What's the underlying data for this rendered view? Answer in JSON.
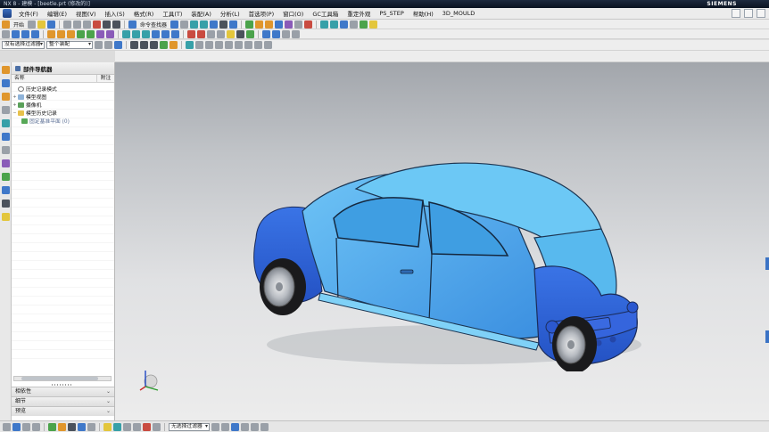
{
  "window": {
    "title": "NX 8 - 建模 - [beetle.prt (修改的)]",
    "brand": "SIEMENS"
  },
  "menu": {
    "items": [
      {
        "label": "文件(F)"
      },
      {
        "label": "编辑(E)"
      },
      {
        "label": "视图(V)"
      },
      {
        "label": "插入(S)"
      },
      {
        "label": "格式(R)"
      },
      {
        "label": "工具(T)"
      },
      {
        "label": "装配(A)"
      },
      {
        "label": "分析(L)"
      },
      {
        "label": "首选项(P)"
      },
      {
        "label": "窗口(O)"
      },
      {
        "label": "GC工具箱"
      },
      {
        "label": "重定外观"
      },
      {
        "label": "PS_STEP"
      },
      {
        "label": "帮助(H)"
      },
      {
        "label": "3D_MOULD"
      }
    ]
  },
  "toolbar": {
    "start_label": "开始",
    "command_finder_label": "命令查找器",
    "selection_filter": "没有选择过滤器",
    "assembly_scope": "整个装配"
  },
  "navigator": {
    "title": "部件导航器",
    "columns": {
      "name": "名称",
      "flag": "附注"
    },
    "tree": [
      {
        "label": "历史记录模式",
        "indent": 0,
        "icon": "history-icon"
      },
      {
        "label": "模型视图",
        "indent": 0,
        "icon": "model-views-icon"
      },
      {
        "label": "摄像机",
        "indent": 0,
        "icon": "camera-icon"
      },
      {
        "label": "模型历史记录",
        "indent": 0,
        "icon": "folder-icon"
      },
      {
        "label": "固定基准平面 (0)",
        "indent": 1,
        "icon": "datum-plane-icon"
      }
    ],
    "panels": [
      {
        "label": "相依性"
      },
      {
        "label": "细节"
      },
      {
        "label": "预览"
      }
    ]
  },
  "statusbar": {
    "filter_label": "无选择过滤器"
  },
  "colors": {
    "car_body_light": "#5fb8ef",
    "car_body_dark": "#2f63d8",
    "background_top": "#9ea2a8",
    "background_bottom": "#ececec"
  }
}
